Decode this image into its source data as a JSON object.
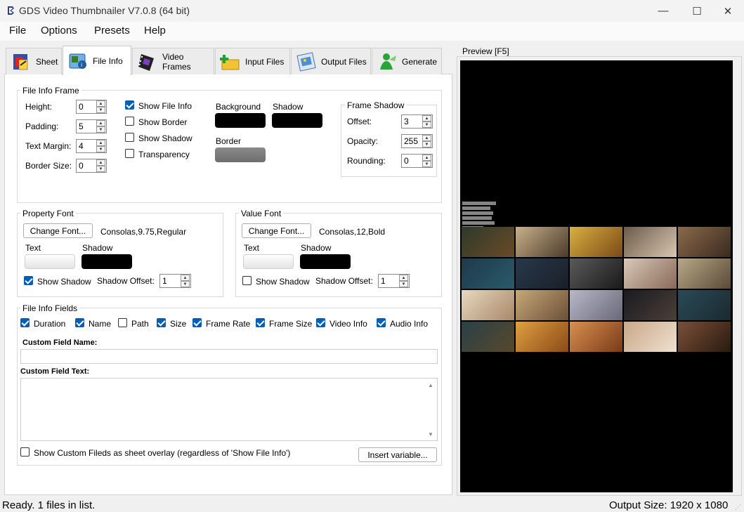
{
  "window": {
    "title": "GDS Video Thumbnailer V7.0.8 (64 bit)",
    "minimize": "—",
    "maximize": "☐",
    "close": "✕"
  },
  "menu": [
    "File",
    "Options",
    "Presets",
    "Help"
  ],
  "tabs": [
    {
      "label": "Sheet",
      "icon": "sheet-icon"
    },
    {
      "label": "File Info",
      "icon": "file-info-icon"
    },
    {
      "label": "Video Frames",
      "icon": "film-icon"
    },
    {
      "label": "Input Files",
      "icon": "folder-add-icon"
    },
    {
      "label": "Output Files",
      "icon": "output-image-icon"
    },
    {
      "label": "Generate",
      "icon": "generate-icon"
    }
  ],
  "active_tab": "File Info",
  "file_info_frame": {
    "title": "File Info Frame",
    "height_label": "Height:",
    "height": "0",
    "padding_label": "Padding:",
    "padding": "5",
    "text_margin_label": "Text Margin:",
    "text_margin": "4",
    "border_size_label": "Border Size:",
    "border_size": "0",
    "show_file_info": {
      "label": "Show File Info",
      "checked": true
    },
    "show_border": {
      "label": "Show Border",
      "checked": false
    },
    "show_shadow": {
      "label": "Show Shadow",
      "checked": false
    },
    "transparency": {
      "label": "Transparency",
      "checked": false
    },
    "background_label": "Background",
    "background_color": "#000000",
    "shadow_label": "Shadow",
    "shadow_color": "#000000",
    "border_label": "Border",
    "border_color": "#808080",
    "frame_shadow": {
      "title": "Frame Shadow",
      "offset_label": "Offset:",
      "offset": "3",
      "opacity_label": "Opacity:",
      "opacity": "255",
      "rounding_label": "Rounding:",
      "rounding": "0"
    }
  },
  "property_font": {
    "title": "Property Font",
    "button": "Change Font...",
    "value": "Consolas,9.75,Regular",
    "text_label": "Text",
    "text_color": "#ffffff",
    "shadow_label": "Shadow",
    "shadow_color": "#000000",
    "show_shadow": {
      "label": "Show Shadow",
      "checked": true
    },
    "shadow_offset_label": "Shadow Offset:",
    "shadow_offset": "1"
  },
  "value_font": {
    "title": "Value Font",
    "button": "Change Font...",
    "value": "Consolas,12,Bold",
    "text_label": "Text",
    "text_color": "#ffffff",
    "shadow_label": "Shadow",
    "shadow_color": "#000000",
    "show_shadow": {
      "label": "Show Shadow",
      "checked": false
    },
    "shadow_offset_label": "Shadow Offset:",
    "shadow_offset": "1"
  },
  "file_info_fields": {
    "title": "File Info Fields",
    "fields": [
      {
        "label": "Duration",
        "checked": true
      },
      {
        "label": "Name",
        "checked": true
      },
      {
        "label": "Path",
        "checked": false
      },
      {
        "label": "Size",
        "checked": true
      },
      {
        "label": "Frame Rate",
        "checked": true
      },
      {
        "label": "Frame Size",
        "checked": true
      },
      {
        "label": "Video Info",
        "checked": true
      },
      {
        "label": "Audio Info",
        "checked": true
      }
    ],
    "custom_name_label": "Custom Field Name:",
    "custom_name_value": "",
    "custom_text_label": "Custom Field Text:",
    "custom_text_value": "",
    "overlay": {
      "label": "Show Custom Fileds as sheet overlay (regardless of 'Show File Info')",
      "checked": false
    },
    "insert_button": "Insert variable..."
  },
  "preview": {
    "label": "Preview  [F5]",
    "background": "#000000"
  },
  "status": {
    "left": "Ready. 1 files in list.",
    "right": "Output Size: 1920 x 1080"
  },
  "colors": {
    "accent": "#005fb8",
    "window": "#f0f0f0",
    "panel": "#ffffff"
  }
}
